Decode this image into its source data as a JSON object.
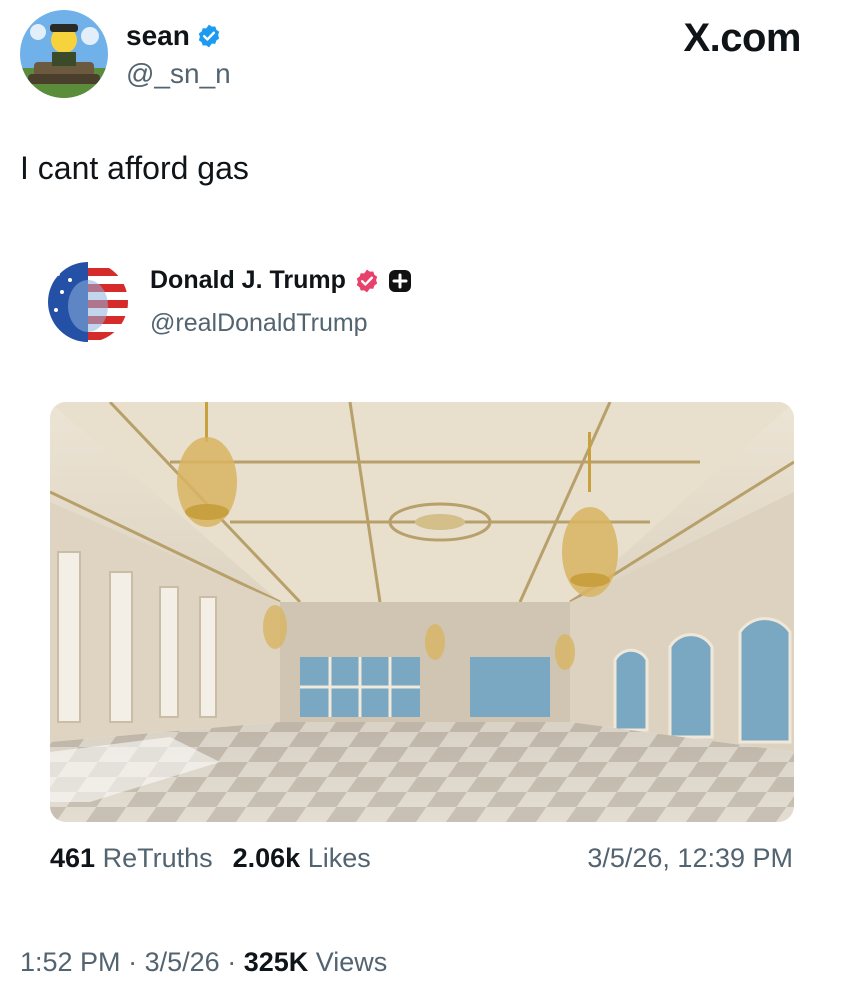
{
  "post": {
    "author_name": "sean",
    "author_handle": "@_sn_n",
    "text": "I cant afford gas",
    "time": "1:52 PM",
    "date": "3/5/26",
    "views_count": "325K",
    "views_label": "Views"
  },
  "site": {
    "label": "X.com"
  },
  "quoted": {
    "author_name": "Donald J. Trump",
    "author_handle": "@realDonaldTrump",
    "retruths_count": "461",
    "retruths_label": "ReTruths",
    "likes_count": "2.06k",
    "likes_label": "Likes",
    "timestamp": "3/5/26, 12:39 PM"
  },
  "colors": {
    "verified_blue": "#1d9bf0",
    "verified_pink": "#e8416b",
    "muted_text": "#536471"
  },
  "icons": [
    "verified-badge-icon",
    "truth-plus-icon"
  ]
}
